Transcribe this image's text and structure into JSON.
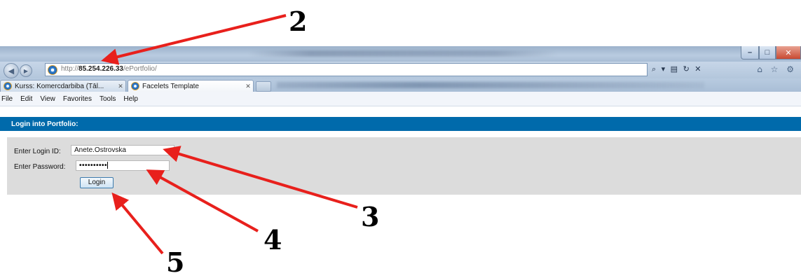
{
  "browser": {
    "address": {
      "prefix": "http://",
      "host": "85.254.226.33",
      "path": "/ePortfolio/"
    },
    "address_tools": "⌕ ▾ ▤ ↻ ✕",
    "right_tools": "⌂ ☆ ⚙",
    "tabs": [
      {
        "label": "Kurss: Komercdarbiba (Tāl...",
        "close": "✕"
      },
      {
        "label": "Facelets Template",
        "close": "✕"
      }
    ],
    "menu": [
      "File",
      "Edit",
      "View",
      "Favorites",
      "Tools",
      "Help"
    ]
  },
  "page": {
    "header": "Login into Portfolio:",
    "login_label": "Enter Login ID:",
    "login_value": "Anete.Ostrovska",
    "password_label": "Enter Password:",
    "password_value": "••••••••••",
    "login_button": "Login"
  },
  "annotations": [
    "2",
    "3",
    "4",
    "5"
  ],
  "colors": {
    "header_bg": "#006aab",
    "panel_bg": "#dcdcdc",
    "arrow": "#e8201c"
  }
}
